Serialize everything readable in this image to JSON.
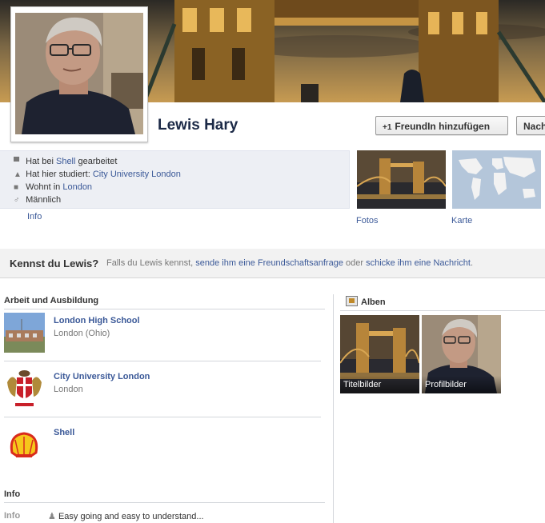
{
  "profile": {
    "name": "Lewis Hary",
    "add_friend_label": "FreundIn hinzufügen",
    "message_label": "Nachricht"
  },
  "about": {
    "work": {
      "prefix": "Hat bei ",
      "link": "Shell",
      "suffix": " gearbeitet"
    },
    "study": {
      "prefix": "Hat hier studiert: ",
      "link": "City University London"
    },
    "lives": {
      "prefix": "Wohnt in ",
      "link": "London"
    },
    "gender": "Männlich",
    "info_link": "Info"
  },
  "thumbs": {
    "photos_label": "Fotos",
    "map_label": "Karte"
  },
  "know_banner": {
    "question": "Kennst du Lewis?",
    "text1": "Falls du Lewis kennst, ",
    "link1": "sende ihm eine Freundschaftsanfrage",
    "text2": " oder ",
    "link2": "schicke ihm eine Nachricht",
    "text3": "."
  },
  "work_edu": {
    "title": "Arbeit und Ausbildung",
    "items": [
      {
        "name": "London High School",
        "sub": "London (Ohio)"
      },
      {
        "name": "City University London",
        "sub": "London"
      },
      {
        "name": "Shell",
        "sub": ""
      }
    ]
  },
  "info_section": {
    "title": "Info",
    "row_label": "Info",
    "row_text": "Easy going and easy to understand..."
  },
  "albums": {
    "title": "Alben",
    "items": [
      {
        "label": "Titelbilder"
      },
      {
        "label": "Profilbilder"
      }
    ]
  },
  "colors": {
    "link": "#3b5998",
    "name": "#1c2a47",
    "info_box_bg": "#edeff4"
  }
}
